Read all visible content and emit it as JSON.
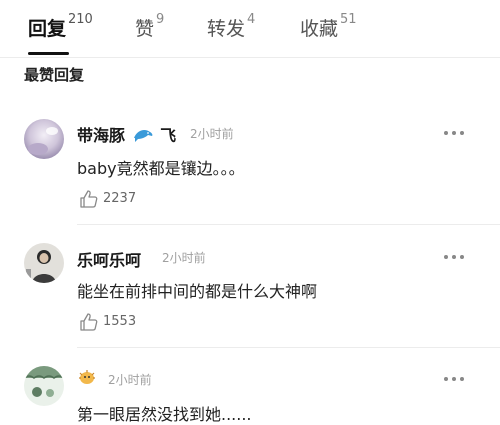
{
  "tabs": [
    {
      "label": "回复",
      "count": "210"
    },
    {
      "label": "赞",
      "count": "9"
    },
    {
      "label": "转发",
      "count": "4"
    },
    {
      "label": "收藏",
      "count": "51"
    }
  ],
  "section_title": "最赞回复",
  "comments": [
    {
      "username": "带海豚",
      "username_suffix": "飞",
      "time": "2小时前",
      "text": "baby竟然都是镶边。。。",
      "likes": "2237"
    },
    {
      "username": "乐呵乐呵",
      "time": "2小时前",
      "text": "能坐在前排中间的都是什么大神啊",
      "likes": "1553"
    },
    {
      "username": "",
      "time": "2小时前",
      "text": "第一眼居然没找到她......"
    }
  ],
  "colors": {
    "accent": "#111111",
    "muted": "#a0a0a0",
    "divider": "#ececec",
    "icon": "#888888"
  },
  "icons": [
    "dolphin-icon",
    "more-icon",
    "thumbs-up-icon",
    "puffer-fish-icon"
  ]
}
